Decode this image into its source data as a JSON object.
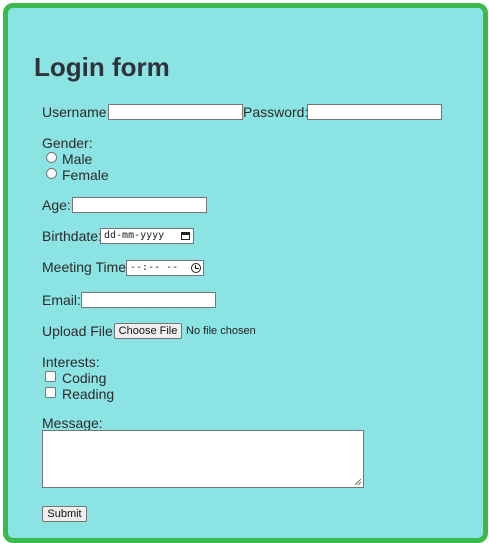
{
  "title": "Login form",
  "username": {
    "label": "Username:",
    "value": ""
  },
  "password": {
    "label": "Password:",
    "value": ""
  },
  "gender": {
    "label": "Gender:",
    "options": [
      "Male",
      "Female"
    ],
    "selected": null
  },
  "age": {
    "label": "Age:",
    "value": ""
  },
  "birthdate": {
    "label": "Birthdate:",
    "placeholder": "dd-mm-yyyy"
  },
  "meeting_time": {
    "label": "Meeting Time:",
    "placeholder": "--:-- --"
  },
  "email": {
    "label": "Email:",
    "value": ""
  },
  "upload": {
    "label": "Upload File:",
    "button": "Choose File",
    "status": "No file chosen"
  },
  "interests": {
    "label": "Interests:",
    "options": [
      "Coding",
      "Reading"
    ],
    "checked": [
      false,
      false
    ]
  },
  "message": {
    "label": "Message:",
    "value": ""
  },
  "submit_label": "Submit",
  "colors": {
    "background": "#8ce3e4",
    "border": "#3bba4b"
  },
  "icons": {
    "birthdate": "calendar-icon",
    "meeting_time": "clock-icon"
  }
}
